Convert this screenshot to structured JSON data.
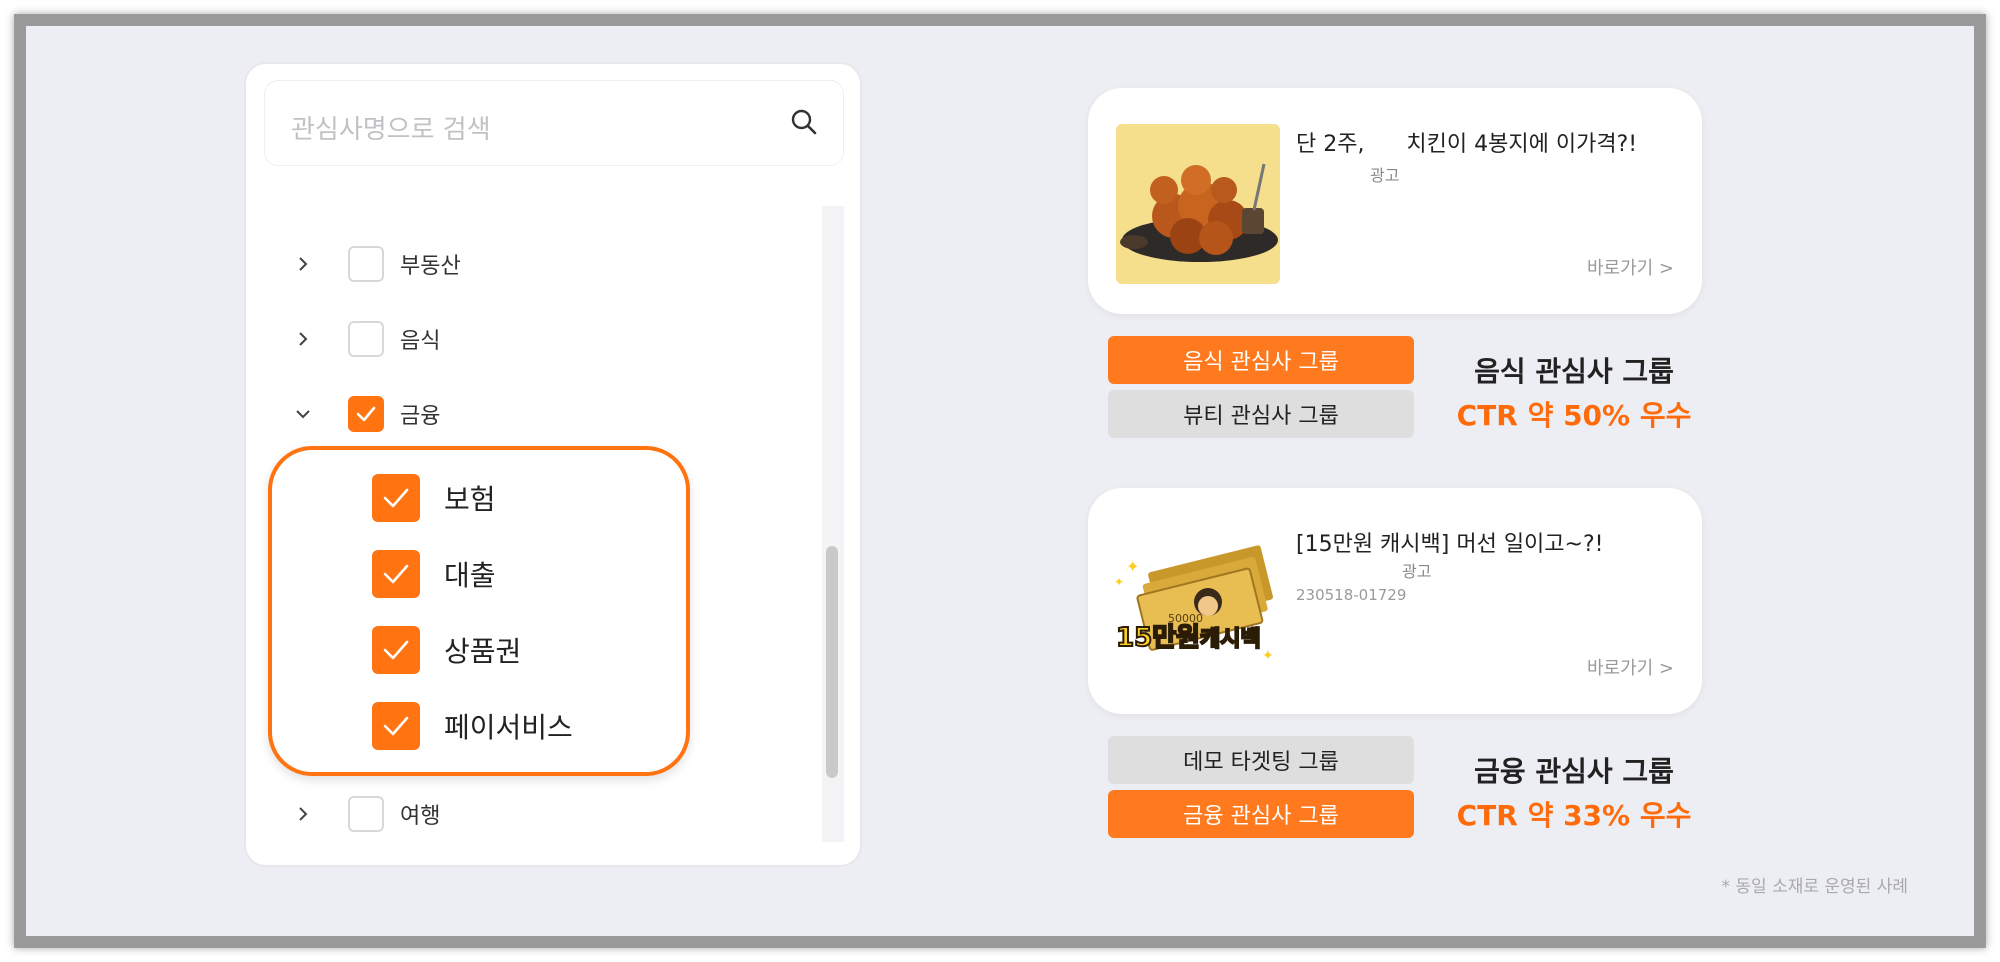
{
  "colors": {
    "accent": "#ff7411",
    "ctr": "#ff6a0a",
    "pill_gray": "#dedede",
    "background": "#edeef3"
  },
  "search": {
    "placeholder": "관심사명으로 검색",
    "icon": "search-icon"
  },
  "tree": {
    "top_items": [
      {
        "label": "부동산",
        "checked": false,
        "expanded": false
      },
      {
        "label": "음식",
        "checked": false,
        "expanded": false
      },
      {
        "label": "금융",
        "checked": true,
        "expanded": true
      }
    ],
    "sub_items": [
      {
        "label": "보험",
        "checked": true
      },
      {
        "label": "대출",
        "checked": true
      },
      {
        "label": "상품권",
        "checked": true
      },
      {
        "label": "페이서비스",
        "checked": true
      }
    ],
    "bottom_item": {
      "label": "여행",
      "checked": false,
      "expanded": false
    }
  },
  "cards": [
    {
      "title": "단 2주,      치킨이 4봉지에 이가격?!",
      "ad_label": "광고",
      "link": "바로가기 >",
      "thumbnail": "fried-chicken-image",
      "pills": [
        {
          "label": "음식 관심사 그룹",
          "style": "orange"
        },
        {
          "label": "뷰티 관심사 그룹",
          "style": "gray"
        }
      ],
      "result": {
        "group": "음식 관심사 그룹",
        "ctr": "CTR 약 50% 우수"
      }
    },
    {
      "title": "[15만원 캐시백] 머선 일이고~?!",
      "ad_label": "광고",
      "code": "230518-01729",
      "link": "바로가기 >",
      "thumbnail": "cashback-money-image",
      "thumb_text": {
        "amount": "15만원",
        "word": "캐시백",
        "bill": "50000"
      },
      "pills": [
        {
          "label": "데모 타겟팅 그룹",
          "style": "gray"
        },
        {
          "label": "금융 관심사 그룹",
          "style": "orange"
        }
      ],
      "result": {
        "group": "금융 관심사 그룹",
        "ctr": "CTR 약 33% 우수"
      }
    }
  ],
  "footnote": "* 동일 소재로 운영된 사례"
}
